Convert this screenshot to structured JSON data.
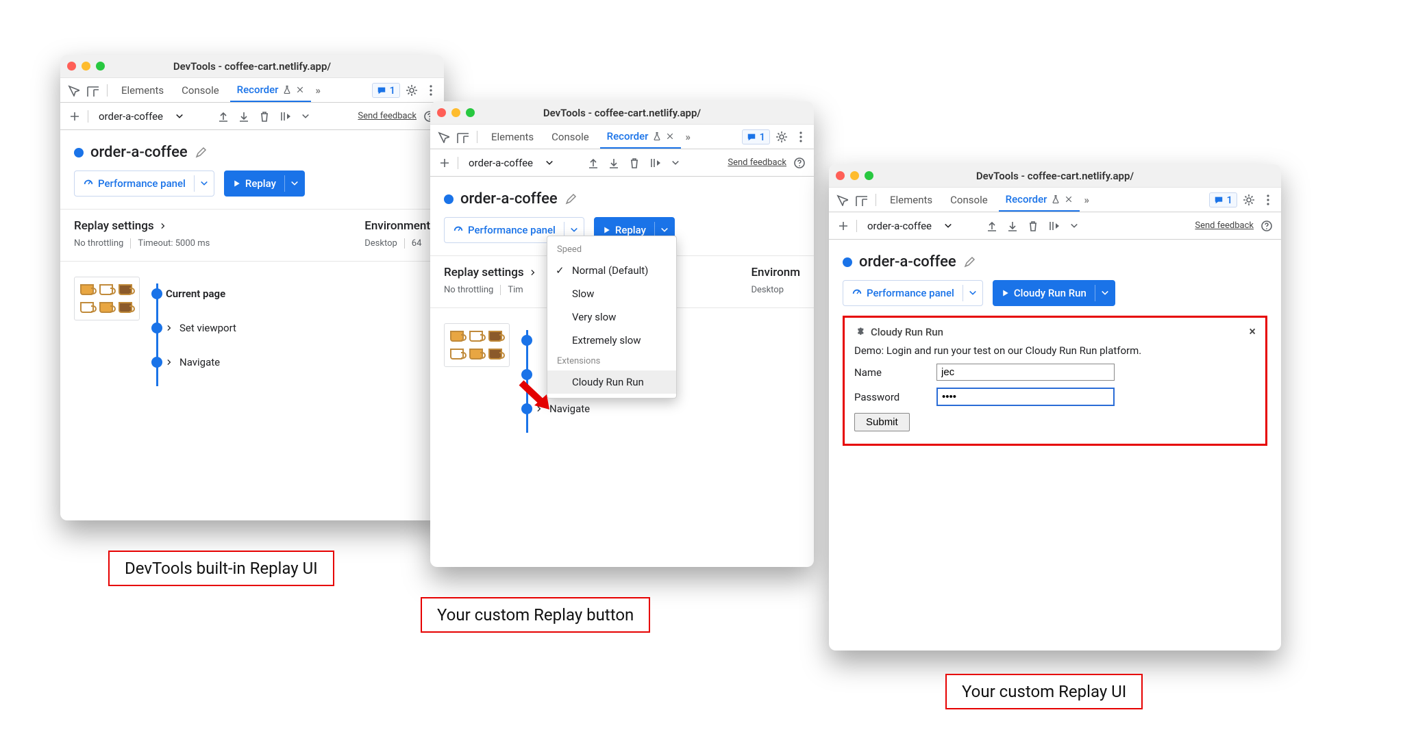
{
  "window_title": "DevTools - coffee-cart.netlify.app/",
  "tabs": {
    "elements": "Elements",
    "console": "Console",
    "recorder": "Recorder",
    "chat_count": "1"
  },
  "toolbar": {
    "recording_name": "order-a-coffee",
    "feedback": "Send feedback"
  },
  "recording": {
    "title": "order-a-coffee"
  },
  "buttons": {
    "perf_panel": "Performance panel",
    "replay": "Replay",
    "cloudy_run": "Cloudy Run Run"
  },
  "replay_settings": {
    "heading": "Replay settings",
    "throttling": "No throttling",
    "timeout": "Timeout: 5000 ms"
  },
  "environment": {
    "heading": "Environment",
    "device": "Desktop",
    "other": "64"
  },
  "steps": [
    "Current page",
    "Set viewport",
    "Navigate"
  ],
  "speed_menu": {
    "speed_hdr": "Speed",
    "items": [
      "Normal (Default)",
      "Slow",
      "Very slow",
      "Extremely slow"
    ],
    "ext_hdr": "Extensions",
    "ext_item": "Cloudy Run Run"
  },
  "ext_panel": {
    "title": "Cloudy Run Run",
    "desc": "Demo: Login and run your test on our Cloudy Run Run platform.",
    "name_label": "Name",
    "name_value": "jec",
    "pwd_label": "Password",
    "pwd_value": "••••",
    "submit": "Submit"
  },
  "captions": {
    "a": "DevTools built-in Replay UI",
    "b": "Your custom Replay button",
    "c": "Your custom Replay UI"
  }
}
